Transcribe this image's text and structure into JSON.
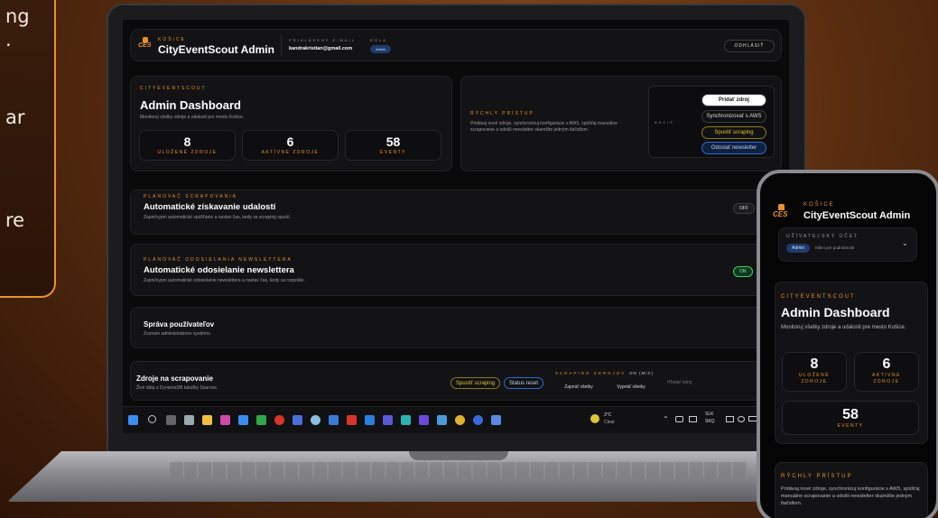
{
  "side_card": {
    "lines": [
      "ng",
      ".",
      "ar",
      "re"
    ]
  },
  "header": {
    "logo_city": "KOŠICE",
    "logo_mark": "CES",
    "title": "CityEventScout Admin",
    "email_label": "PRIHLÁSENÝ E-MAIL",
    "email_value": "kandrakristian@gmail.com",
    "role_label": "ROLA",
    "role_value": "Admin",
    "logout_label": "ODHLÁSIŤ"
  },
  "dashboard": {
    "eyebrow": "CITYEVENTSCOUT",
    "title": "Admin Dashboard",
    "subtitle": "Monitoruj všetky zdroje a udalosti pre mesto Košice.",
    "stats": [
      {
        "value": "8",
        "label": "ULOŽENÉ ZDROJE"
      },
      {
        "value": "6",
        "label": "AKTÍVNE ZDROJE"
      },
      {
        "value": "58",
        "label": "EVENTY"
      }
    ]
  },
  "quick_access": {
    "eyebrow": "RÝCHLY PRÍSTUP",
    "description": "Pridávaj nové zdroje, synchronizuj konfigurácie s AWS, spúšťaj manuálne scrapovanie a odošli newsletter okamžite jedným tlačidlom.",
    "akcie_label": "AKCIE",
    "buttons": [
      "Pridať zdroj",
      "Synchronizovať s AWS",
      "Spustiť scraping",
      "Odoslať newsletter"
    ]
  },
  "scraping_scheduler": {
    "eyebrow": "PLÁNOVAČ SCRAPOVANIA",
    "title": "Automatické získavanie udalostí",
    "desc": "Zapni/vypni automatické spúšťanie a nastav čas, kedy sa scraping spustí.",
    "toggle": "OFF"
  },
  "newsletter_scheduler": {
    "eyebrow": "PLÁNOVAČ ODOSIELANIA NEWSLETTERA",
    "title": "Automatické odosielanie newslettera",
    "desc": "Zapni/vypni automatické odosielanie newslettera a nastav čas, kedy sa rozpošle.",
    "toggle": "ON"
  },
  "users": {
    "title": "Správa používateľov",
    "desc": "Zoznam administrátorov systému."
  },
  "sources": {
    "title": "Zdroje na scrapovanie",
    "desc": "Živé dáta z DynamoDB tabuľky Sources.",
    "btn_scrape": "Spustiť scraping",
    "btn_reset": "Status reset",
    "scraping_label": "SCRAPING ZDROJOV",
    "scraping_value": "ON (MIX)",
    "btn_enable_all": "Zapnúť všetky",
    "btn_disable_all": "Vypnúť všetky",
    "search_placeholder": "Hľadať zdroj"
  },
  "taskbar": {
    "weather_temp": "3°C",
    "weather_desc": "Clear",
    "lang": "SLK",
    "lang2": "SKQ"
  },
  "phone": {
    "logo_city": "KOŠICE",
    "logo_mark": "CES",
    "title": "CityEventScout Admin",
    "account_label": "UŽÍVATEĽSKÝ ÚČET",
    "role_value": "Admin",
    "account_hint": "Klikni pre podrobnosti",
    "eyebrow": "CITYEVENTSCOUT",
    "dash_title": "Admin Dashboard",
    "dash_subtitle": "Monitoruj všetky zdroje a udalosti pre mesto Košice.",
    "stats": [
      {
        "value": "8",
        "label": "ULOŽENÉ ZDROJE"
      },
      {
        "value": "6",
        "label": "AKTÍVNE ZDROJE"
      },
      {
        "value": "58",
        "label": "EVENTY"
      }
    ],
    "quick_eyebrow": "RÝCHLY PRÍSTUP",
    "quick_desc": "Pridávaj nové zdroje, synchronizuj konfigurácie s AWS, spúšťaj manuálne scrapovanie a odošli newsletter okamžite jedným tlačidlom."
  },
  "colors": {
    "accent": "#e8922e",
    "on_green": "#3ecf6a",
    "blue_btn": "#2e6bd6",
    "yellow_btn": "#e0c43a"
  }
}
